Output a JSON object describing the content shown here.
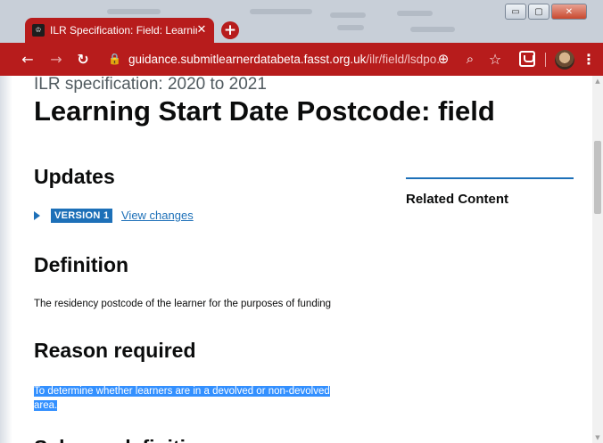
{
  "browser": {
    "tab_title": "ILR Specification: Field: Learning",
    "tab_close": "✕",
    "new_tab": "+",
    "window_controls": {
      "minimize": "▭",
      "maximize": "▢",
      "close": "✕"
    },
    "url_host": "guidance.submitlearnerdatabeta.fasst.org.uk",
    "url_path": "/ilr/field/lsdpo...",
    "icons": [
      "back-icon",
      "forward-icon",
      "reload-icon",
      "lock-icon",
      "add-icon",
      "zoom-icon",
      "bookmark-star-icon",
      "extension-icon",
      "avatar",
      "menu-icon"
    ]
  },
  "page": {
    "caption": "ILR specification: 2020 to 2021",
    "title": "Learning Start Date Postcode: field",
    "updates": {
      "heading": "Updates",
      "badge": "VERSION 1",
      "link": "View changes"
    },
    "definition": {
      "heading": "Definition",
      "text": "The residency postcode of the learner for the purposes of funding"
    },
    "reason": {
      "heading": "Reason required",
      "line1": "To determine whether learners are in a devolved or non-devolved",
      "line2": "area."
    },
    "related": {
      "heading": "Related Content"
    },
    "next_heading": "Schema definition"
  },
  "colors": {
    "browser_red": "#b71c1c",
    "link_blue": "#1d70b8",
    "selection_blue": "#3390ff",
    "text": "#0b0c0c"
  }
}
